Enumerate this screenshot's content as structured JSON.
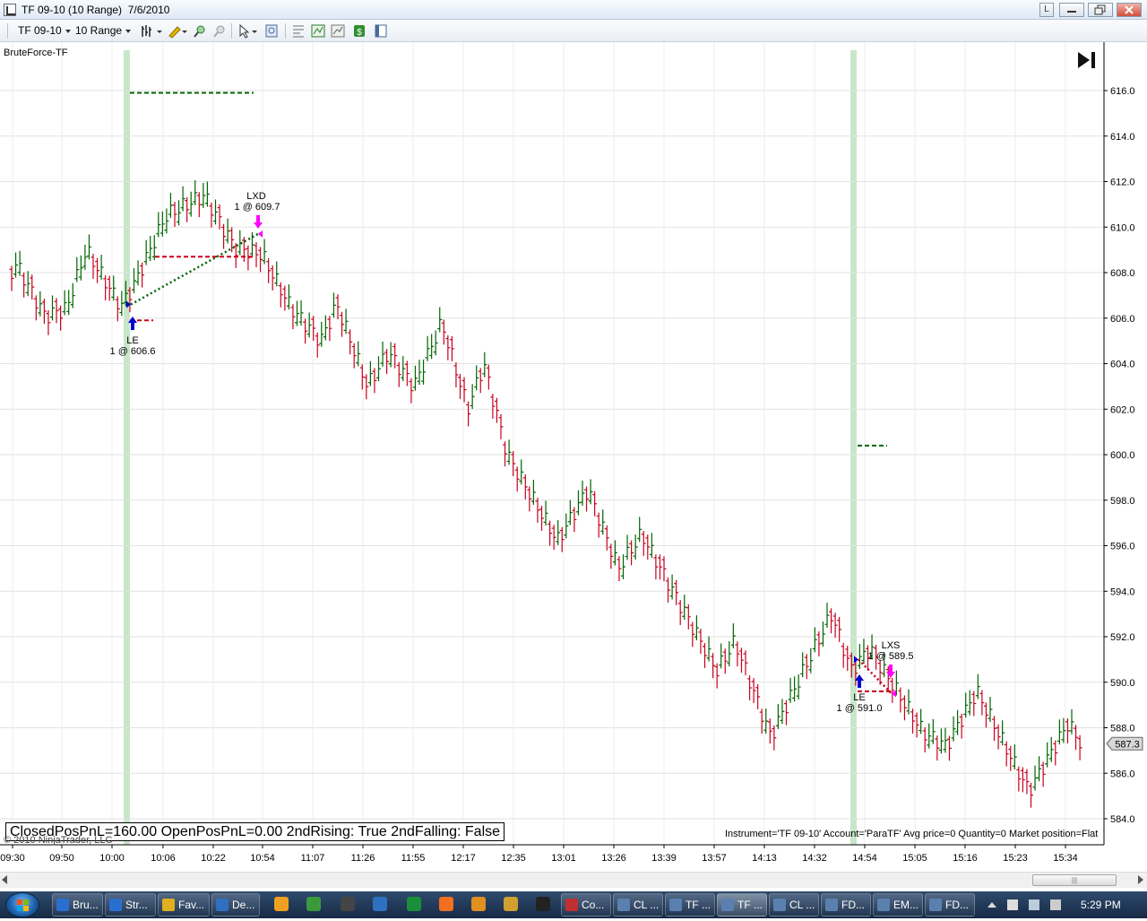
{
  "window": {
    "title": "TF 09-10 (10 Range)  7/6/2010",
    "btn_l_label": "L"
  },
  "toolbar": {
    "instrument": "TF 09-10",
    "interval": "10 Range",
    "icons": [
      "bar-style-icon",
      "drawing-pencil-icon",
      "zoom-in-icon",
      "zoom-out-icon",
      "pointer-icon",
      "data-box-icon",
      "strategies-icon",
      "indicators-icon",
      "chart-trader-icon",
      "properties-icon"
    ]
  },
  "chart": {
    "strategy_label": "BruteForce-TF",
    "status_text": "ClosedPosPnL=160.00 OpenPosPnL=0.00 2ndRising: True 2ndFalling: False",
    "copyright": "© 2010 NinjaTrader, LLC",
    "account_info": "Instrument='TF 09-10' Account='ParaTF' Avg price=0 Quantity=0 Market position=Flat",
    "price_marker": "587.3",
    "y_labels": [
      "616.0",
      "614.0",
      "612.0",
      "610.0",
      "608.0",
      "606.0",
      "604.0",
      "602.0",
      "600.0",
      "598.0",
      "596.0",
      "594.0",
      "592.0",
      "590.0",
      "588.0",
      "586.0",
      "584.0"
    ],
    "x_labels": [
      "09:30",
      "09:50",
      "10:00",
      "10:06",
      "10:22",
      "10:54",
      "11:07",
      "11:26",
      "11:55",
      "12:17",
      "12:35",
      "13:01",
      "13:26",
      "13:39",
      "13:57",
      "14:13",
      "14:32",
      "14:54",
      "15:05",
      "15:16",
      "15:23",
      "15:34"
    ],
    "trades": [
      {
        "entry_label": "LE",
        "entry_text": "1 @ 606.6",
        "exit_label": "LXD",
        "exit_text": "1 @ 609.7"
      },
      {
        "entry_label": "LE",
        "entry_text": "1 @ 591.0",
        "exit_label": "LXS",
        "exit_text": "1 @ 589.5"
      }
    ],
    "colors": {
      "up": "#006400",
      "down": "#c8001e",
      "highlight": "#c8e6c9",
      "entry_arrow": "#0000cc",
      "exit_arrow": "#ff00ff"
    }
  },
  "taskbar": {
    "buttons": [
      "Bru...",
      "Str...",
      "Fav...",
      "De...",
      "Co...",
      "CL ...",
      "TF ...",
      "TF ...",
      "CL ...",
      "FD...",
      "EM...",
      "FD..."
    ],
    "clock": "5:29 PM"
  }
}
